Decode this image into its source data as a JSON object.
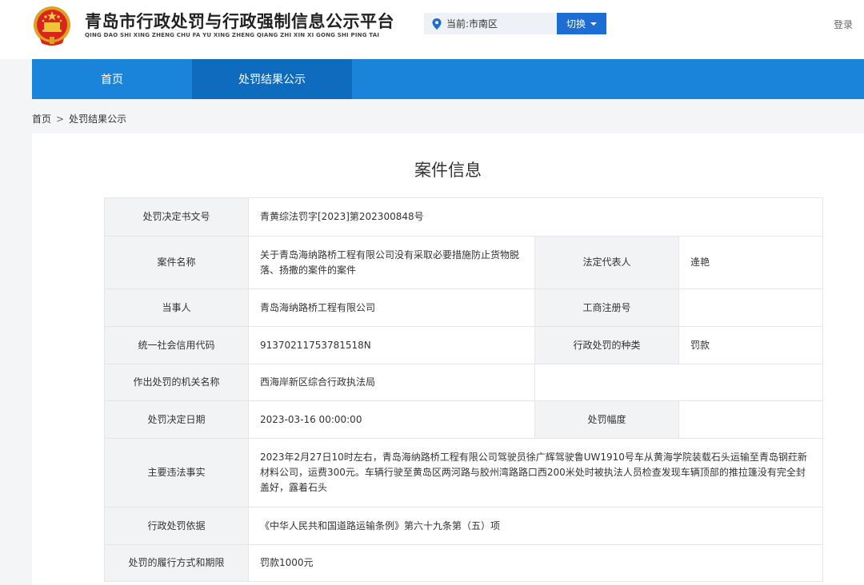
{
  "site": {
    "title": "青岛市行政处罚与行政强制信息公示平台",
    "pinyin": "QING DAO SHI XING ZHENG CHU FA YU XING ZHENG QIANG ZHI XIN XI GONG SHI PING TAI",
    "location": "当前:市南区",
    "switch_label": "切换",
    "login_label": "登录"
  },
  "nav": {
    "home": "首页",
    "results": "处罚结果公示"
  },
  "breadcrumb": {
    "home": "首页",
    "sep": ">",
    "current": "处罚结果公示"
  },
  "case": {
    "title": "案件信息",
    "rows": {
      "doc_no": {
        "label": "处罚决定书文号",
        "value": "青黄综法罚字[2023]第202300848号"
      },
      "case_name": {
        "label": "案件名称",
        "value": "关于青岛海纳路桥工程有限公司没有采取必要措施防止货物脱落、扬撒的案件的案件"
      },
      "legal_rep": {
        "label": "法定代表人",
        "value": "逄艳"
      },
      "party": {
        "label": "当事人",
        "value": "青岛海纳路桥工程有限公司"
      },
      "biz_reg": {
        "label": "工商注册号",
        "value": ""
      },
      "credit_code": {
        "label": "统一社会信用代码",
        "value": "91370211753781518N"
      },
      "penalty_type": {
        "label": "行政处罚的种类",
        "value": "罚款"
      },
      "authority": {
        "label": "作出处罚的机关名称",
        "value": "西海岸新区综合行政执法局"
      },
      "date": {
        "label": "处罚决定日期",
        "value": "2023-03-16 00:00:00"
      },
      "range": {
        "label": "处罚幅度",
        "value": ""
      },
      "facts": {
        "label": "主要违法事实",
        "value": "2023年2月27日10时左右，青岛海纳路桥工程有限公司驾驶员徐广辉驾驶鲁UW1910号车从黄海学院装载石头运输至青岛钢荭新材料公司，运费300元。车辆行驶至黄岛区两河路与胶州湾路路口西200米处时被执法人员检查发现车辆顶部的推拉篷没有完全封盖好，露着石头"
      },
      "basis": {
        "label": "行政处罚依据",
        "value": "《中华人民共和国道路运输条例》第六十九条第（五）项"
      },
      "execution": {
        "label": "处罚的履行方式和期限",
        "value": "罚款1000元"
      }
    }
  },
  "colors": {
    "nav_bg": "#1a84db",
    "nav_active": "#0f6bbd",
    "switch_bg": "#1d6ed4",
    "label_bg": "#f2f3f5"
  },
  "icons": [
    "emblem-icon",
    "location-pin-icon",
    "caret-down-icon"
  ]
}
